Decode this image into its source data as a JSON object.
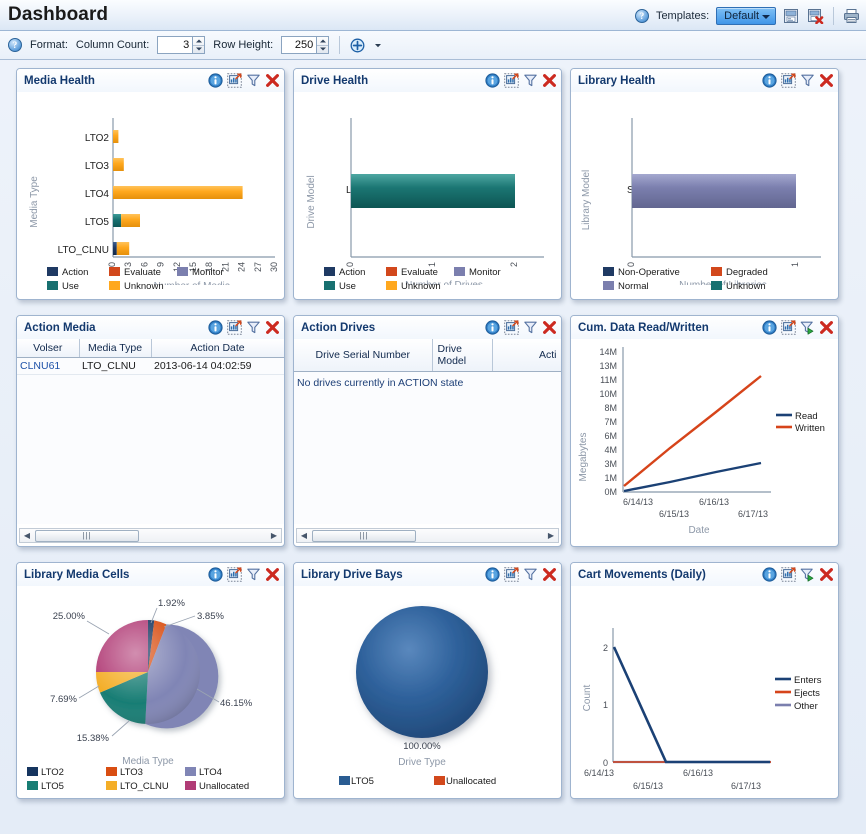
{
  "titlebar": {
    "title": "Dashboard",
    "help_icon": "help-icon",
    "templates_label": "Templates:",
    "template_selected": "Default",
    "save_template_icon": "save-template-icon",
    "delete_template_icon": "delete-template-icon",
    "print_icon": "print-icon"
  },
  "formatbar": {
    "help_icon": "help-icon",
    "format_label": "Format:",
    "column_count_label": "Column Count:",
    "column_count_value": "3",
    "row_height_label": "Row Height:",
    "row_height_value": "250",
    "add_icon": "add-portlet-icon",
    "dropdown_icon": "chevron-down-icon"
  },
  "panel_tools": {
    "info": "info-icon",
    "popout": "popout-chart-icon",
    "filter": "filter-icon",
    "filter_run": "filter-run-icon",
    "close": "close-icon"
  },
  "panels": {
    "media_health": {
      "title": "Media Health"
    },
    "drive_health": {
      "title": "Drive Health"
    },
    "library_health": {
      "title": "Library Health"
    },
    "action_media": {
      "title": "Action Media"
    },
    "action_drives": {
      "title": "Action Drives"
    },
    "cum_data": {
      "title": "Cum. Data Read/Written"
    },
    "library_media_cells": {
      "title": "Library Media Cells"
    },
    "library_drive_bays": {
      "title": "Library Drive Bays"
    },
    "cart_movements": {
      "title": "Cart Movements (Daily)"
    }
  },
  "tables": {
    "action_media": {
      "columns": [
        "Volser",
        "Media Type",
        "Action Date"
      ],
      "rows": [
        [
          "CLNU61",
          "LTO_CLNU",
          "2013-06-14 04:02:59"
        ]
      ],
      "scroll_thumb_icon": "scrollbar-thumb-grip",
      "left_arrow_icon": "scroll-left-icon",
      "right_arrow_icon": "scroll-right-icon"
    },
    "action_drives": {
      "columns": [
        "Drive Serial Number",
        "Drive Model",
        "Acti"
      ],
      "rows": [],
      "empty_message": "No drives currently in ACTION state",
      "scroll_thumb_icon": "scrollbar-thumb-grip",
      "left_arrow_icon": "scroll-left-icon",
      "right_arrow_icon": "scroll-right-icon"
    }
  },
  "colors": {
    "action": "#1F3A63",
    "evaluate": "#D2481C",
    "monitor": "#7B7FAE",
    "use": "#187070",
    "unknown": "#FFA81E",
    "non_operative": "#1F3A63",
    "degraded": "#D2481C",
    "normal": "#7B7FAE",
    "pie_lto2": "#16355F",
    "pie_lto3": "#D94E12",
    "pie_lto4": "#8085B5",
    "pie_lto5": "#187D74",
    "pie_lto_clnu": "#F4AE28",
    "pie_unallocated": "#B13C76",
    "bay_lto5": "#2A5C92",
    "bay_unallocated": "#D2481C",
    "read_line": "#1B4175",
    "written_line": "#D6441A",
    "enters_line": "#1B4175",
    "ejects_line": "#D6441A",
    "other_line": "#7B7FAE"
  },
  "chart_data": [
    {
      "id": "media_health",
      "type": "bar",
      "orientation": "horizontal",
      "title": "Media Health",
      "xlabel": "Number of Media",
      "ylabel": "Media Type",
      "categories": [
        "LTO2",
        "LTO3",
        "LTO4",
        "LTO5",
        "LTO_CLNU"
      ],
      "xticks": [
        "0",
        "3",
        "6",
        "9",
        "12",
        "15",
        "18",
        "21",
        "24",
        "27",
        "30"
      ],
      "xlim": [
        0,
        30
      ],
      "grid": false,
      "legend": [
        "Action",
        "Evaluate",
        "Monitor",
        "Use",
        "Unknown"
      ],
      "legend_position": "bottom",
      "series": [
        {
          "name": "Action",
          "values": [
            0,
            0,
            0,
            0,
            0.7
          ]
        },
        {
          "name": "Evaluate",
          "values": [
            0,
            0,
            0,
            0,
            0
          ]
        },
        {
          "name": "Monitor",
          "values": [
            0,
            0,
            0,
            0,
            0
          ]
        },
        {
          "name": "Use",
          "values": [
            0,
            0,
            0,
            1.5,
            0
          ]
        },
        {
          "name": "Unknown",
          "values": [
            1,
            2,
            24,
            3.5,
            2.3
          ]
        }
      ]
    },
    {
      "id": "drive_health",
      "type": "bar",
      "orientation": "horizontal",
      "title": "Drive Health",
      "xlabel": "Number of Drives",
      "ylabel": "Drive Model",
      "categories": [
        "LTO5"
      ],
      "xticks": [
        "0",
        "1",
        "2"
      ],
      "xlim": [
        0,
        2
      ],
      "grid": false,
      "legend": [
        "Action",
        "Evaluate",
        "Monitor",
        "Use",
        "Unknown"
      ],
      "legend_position": "bottom",
      "series": [
        {
          "name": "Action",
          "values": [
            0
          ]
        },
        {
          "name": "Evaluate",
          "values": [
            0
          ]
        },
        {
          "name": "Monitor",
          "values": [
            0
          ]
        },
        {
          "name": "Use",
          "values": [
            2
          ]
        },
        {
          "name": "Unknown",
          "values": [
            0
          ]
        }
      ]
    },
    {
      "id": "library_health",
      "type": "bar",
      "orientation": "horizontal",
      "title": "Library Health",
      "xlabel": "Number of Libraries",
      "ylabel": "Library Model",
      "categories": [
        "SL500"
      ],
      "xticks": [
        "0",
        "1"
      ],
      "xlim": [
        0,
        1
      ],
      "grid": false,
      "legend": [
        "Non-Operative",
        "Degraded",
        "Normal",
        "Unknown"
      ],
      "legend_position": "bottom",
      "series": [
        {
          "name": "Non-Operative",
          "values": [
            0
          ]
        },
        {
          "name": "Degraded",
          "values": [
            0
          ]
        },
        {
          "name": "Normal",
          "values": [
            1
          ]
        },
        {
          "name": "Unknown",
          "values": [
            0
          ]
        }
      ]
    },
    {
      "id": "cum_data",
      "type": "line",
      "title": "Cum. Data Read/Written",
      "xlabel": "Date",
      "ylabel": "Megabytes",
      "x": [
        "6/14/13",
        "6/15/13",
        "6/16/13",
        "6/17/13"
      ],
      "yticks": [
        "0M",
        "1M",
        "3M",
        "4M",
        "6M",
        "7M",
        "8M",
        "10M",
        "11M",
        "13M",
        "14M"
      ],
      "ylim": [
        0,
        14
      ],
      "grid": false,
      "legend": [
        "Read",
        "Written"
      ],
      "legend_position": "right",
      "series": [
        {
          "name": "Read",
          "values": [
            0.1,
            1.0,
            2.0,
            2.9
          ]
        },
        {
          "name": "Written",
          "values": [
            0.6,
            4.4,
            8.0,
            11.5
          ]
        }
      ]
    },
    {
      "id": "library_media_cells",
      "type": "pie",
      "title": "Library Media Cells",
      "legend_title": "Media Type",
      "labels": [
        "LTO2",
        "LTO3",
        "LTO4",
        "LTO5",
        "LTO_CLNU",
        "Unallocated"
      ],
      "values": [
        1.92,
        3.85,
        46.15,
        15.38,
        7.69,
        25.0
      ],
      "value_labels": [
        "1.92%",
        "3.85%",
        "46.15%",
        "15.38%",
        "7.69%",
        "25.00%"
      ],
      "legend_position": "bottom"
    },
    {
      "id": "library_drive_bays",
      "type": "pie",
      "title": "Library Drive Bays",
      "legend_title": "Drive Type",
      "labels": [
        "LTO5",
        "Unallocated"
      ],
      "values": [
        100.0,
        0
      ],
      "value_labels": [
        "100.00%"
      ],
      "legend_position": "bottom"
    },
    {
      "id": "cart_movements",
      "type": "line",
      "title": "Cart Movements (Daily)",
      "xlabel": "Date",
      "ylabel": "Count",
      "x": [
        "6/14/13",
        "6/15/13",
        "6/16/13",
        "6/17/13"
      ],
      "yticks": [
        "0",
        "1",
        "2"
      ],
      "ylim": [
        0,
        2
      ],
      "grid": false,
      "legend": [
        "Enters",
        "Ejects",
        "Other"
      ],
      "legend_position": "right",
      "series": [
        {
          "name": "Enters",
          "values": [
            2,
            0,
            0,
            0
          ]
        },
        {
          "name": "Ejects",
          "values": [
            0,
            0,
            0,
            0
          ]
        },
        {
          "name": "Other",
          "values": [
            0,
            0,
            0,
            0
          ]
        }
      ]
    }
  ]
}
